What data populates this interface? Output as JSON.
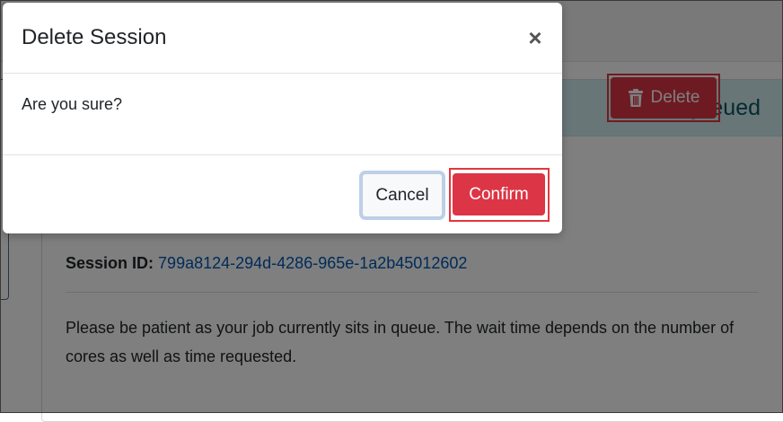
{
  "background": {
    "status": "Queued",
    "delete_label": "Delete",
    "session_id_label": "Session ID:",
    "session_id_value": "799a8124-294d-4286-965e-1a2b45012602",
    "queue_message": "Please be patient as your job currently sits in queue. The wait time depends on the number of cores as well as time requested."
  },
  "modal": {
    "title": "Delete Session",
    "close_glyph": "×",
    "body_text": "Are you sure?",
    "cancel_label": "Cancel",
    "confirm_label": "Confirm"
  },
  "colors": {
    "danger": "#dc3545",
    "info_bg": "#d1ecf1",
    "info_text": "#0c5460",
    "link": "#0056b3",
    "highlight": "#e0383e"
  },
  "icons": {
    "delete_button_icon": "trash-icon",
    "close_icon": "close-icon"
  }
}
